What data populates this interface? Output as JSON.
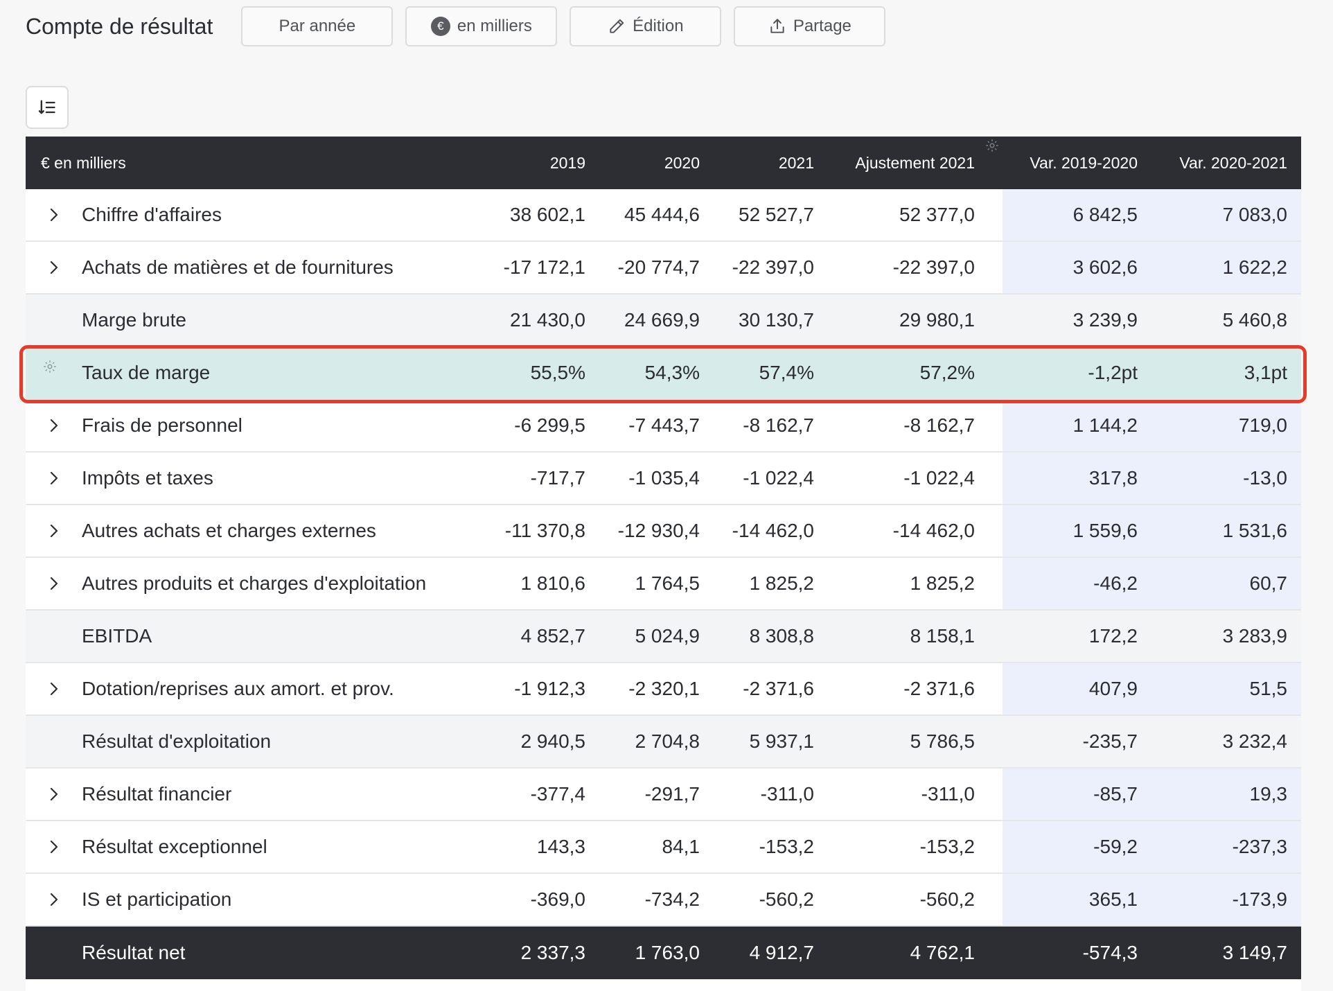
{
  "header": {
    "title": "Compte de résultat",
    "buttons": {
      "period": "Par année",
      "unit": "en milliers",
      "edit": "Édition",
      "share": "Partage"
    },
    "unit_badge": "€"
  },
  "table": {
    "columns": [
      "€ en milliers",
      "2019",
      "2020",
      "2021",
      "Ajustement 2021",
      "Var. 2019-2020",
      "Var. 2020-2021"
    ],
    "rows": [
      {
        "label": "Chiffre d'affaires",
        "expandable": true,
        "type": "line",
        "values": [
          "38 602,1",
          "45 444,6",
          "52 527,7",
          "52 377,0",
          "6 842,5",
          "7 083,0"
        ]
      },
      {
        "label": "Achats de matières et de fournitures",
        "expandable": true,
        "type": "line",
        "values": [
          "-17 172,1",
          "-20 774,7",
          "-22 397,0",
          "-22 397,0",
          "3 602,6",
          "1 622,2"
        ]
      },
      {
        "label": "Marge brute",
        "expandable": false,
        "type": "subtotal",
        "values": [
          "21 430,0",
          "24 669,9",
          "30 130,7",
          "29 980,1",
          "3 239,9",
          "5 460,8"
        ]
      },
      {
        "label": "Taux de marge",
        "expandable": false,
        "type": "highlight",
        "values": [
          "55,5%",
          "54,3%",
          "57,4%",
          "57,2%",
          "-1,2pt",
          "3,1pt"
        ]
      },
      {
        "label": "Frais de personnel",
        "expandable": true,
        "type": "line",
        "values": [
          "-6 299,5",
          "-7 443,7",
          "-8 162,7",
          "-8 162,7",
          "1 144,2",
          "719,0"
        ]
      },
      {
        "label": "Impôts et taxes",
        "expandable": true,
        "type": "line",
        "values": [
          "-717,7",
          "-1 035,4",
          "-1 022,4",
          "-1 022,4",
          "317,8",
          "-13,0"
        ]
      },
      {
        "label": "Autres achats et charges externes",
        "expandable": true,
        "type": "line",
        "values": [
          "-11 370,8",
          "-12 930,4",
          "-14 462,0",
          "-14 462,0",
          "1 559,6",
          "1 531,6"
        ]
      },
      {
        "label": "Autres produits et charges d'exploitation",
        "expandable": true,
        "type": "line",
        "values": [
          "1 810,6",
          "1 764,5",
          "1 825,2",
          "1 825,2",
          "-46,2",
          "60,7"
        ]
      },
      {
        "label": "EBITDA",
        "expandable": false,
        "type": "subtotal",
        "values": [
          "4 852,7",
          "5 024,9",
          "8 308,8",
          "8 158,1",
          "172,2",
          "3 283,9"
        ]
      },
      {
        "label": "Dotation/reprises aux amort. et prov.",
        "expandable": true,
        "type": "line",
        "values": [
          "-1 912,3",
          "-2 320,1",
          "-2 371,6",
          "-2 371,6",
          "407,9",
          "51,5"
        ]
      },
      {
        "label": "Résultat d'exploitation",
        "expandable": false,
        "type": "subtotal",
        "values": [
          "2 940,5",
          "2 704,8",
          "5 937,1",
          "5 786,5",
          "-235,7",
          "3 232,4"
        ]
      },
      {
        "label": "Résultat financier",
        "expandable": true,
        "type": "line",
        "values": [
          "-377,4",
          "-291,7",
          "-311,0",
          "-311,0",
          "-85,7",
          "19,3"
        ]
      },
      {
        "label": "Résultat exceptionnel",
        "expandable": true,
        "type": "line",
        "values": [
          "143,3",
          "84,1",
          "-153,2",
          "-153,2",
          "-59,2",
          "-237,3"
        ]
      },
      {
        "label": "IS et participation",
        "expandable": true,
        "type": "line",
        "values": [
          "-369,0",
          "-734,2",
          "-560,2",
          "-560,2",
          "365,1",
          "-173,9"
        ]
      },
      {
        "label": "Résultat net",
        "expandable": false,
        "type": "total",
        "values": [
          "2 337,3",
          "1 763,0",
          "4 912,7",
          "4 762,1",
          "-574,3",
          "3 149,7"
        ]
      }
    ]
  },
  "colors": {
    "header_bg": "#2c2e33",
    "variance_shade": "#eceffc",
    "subtotal_bg": "#f3f4f6",
    "highlight_bg": "#d6ebea",
    "selection_outline": "#e63b2a"
  },
  "icons": {
    "sort": "sort-list-icon",
    "edit": "pencil-icon",
    "share": "share-upload-icon",
    "expand": "chevron-right-icon",
    "settings": "gear-icon"
  }
}
